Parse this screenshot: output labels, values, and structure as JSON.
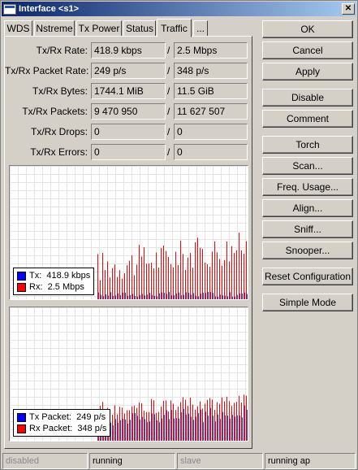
{
  "window": {
    "title": "Interface <s1>",
    "close_glyph": "✕"
  },
  "tabs": [
    {
      "label": "WDS"
    },
    {
      "label": "Nstreme"
    },
    {
      "label": "Tx Power"
    },
    {
      "label": "Status"
    },
    {
      "label": "Traffic"
    },
    {
      "label": "..."
    }
  ],
  "active_tab": "Traffic",
  "stats": [
    {
      "label": "Tx/Rx Rate:",
      "tx": "418.9 kbps",
      "rx": "2.5 Mbps"
    },
    {
      "label": "Tx/Rx Packet Rate:",
      "tx": "249 p/s",
      "rx": "348 p/s"
    },
    {
      "label": "Tx/Rx Bytes:",
      "tx": "1744.1 MiB",
      "rx": "11.5 GiB"
    },
    {
      "label": "Tx/Rx Packets:",
      "tx": "9 470 950",
      "rx": "11 627 507"
    },
    {
      "label": "Tx/Rx Drops:",
      "tx": "0",
      "rx": "0"
    },
    {
      "label": "Tx/Rx Errors:",
      "tx": "0",
      "rx": "0"
    }
  ],
  "separator": "/",
  "graphs": [
    {
      "legend": [
        {
          "prefix": "Tx:",
          "value": "418.9 kbps",
          "color": "#0000ff"
        },
        {
          "prefix": "Rx:",
          "value": "2.5 Mbps",
          "color": "#ff0000"
        }
      ]
    },
    {
      "legend": [
        {
          "prefix": "Tx Packet:",
          "value": "249 p/s",
          "color": "#0000ff"
        },
        {
          "prefix": "Rx Packet:",
          "value": "348 p/s",
          "color": "#ff0000"
        }
      ]
    }
  ],
  "buttons": {
    "ok": "OK",
    "cancel": "Cancel",
    "apply": "Apply",
    "disable": "Disable",
    "comment": "Comment",
    "torch": "Torch",
    "scan": "Scan...",
    "freq_usage": "Freq. Usage...",
    "align": "Align...",
    "sniff": "Sniff...",
    "snooper": "Snooper...",
    "reset_configuration": "Reset Configuration",
    "simple_mode": "Simple Mode"
  },
  "statusbar": [
    "disabled",
    "running",
    "slave",
    "running ap"
  ],
  "colors": {
    "tx": "#0000ff",
    "rx": "#ff0000",
    "title_start": "#0a246a",
    "title_end": "#a6caf0"
  }
}
